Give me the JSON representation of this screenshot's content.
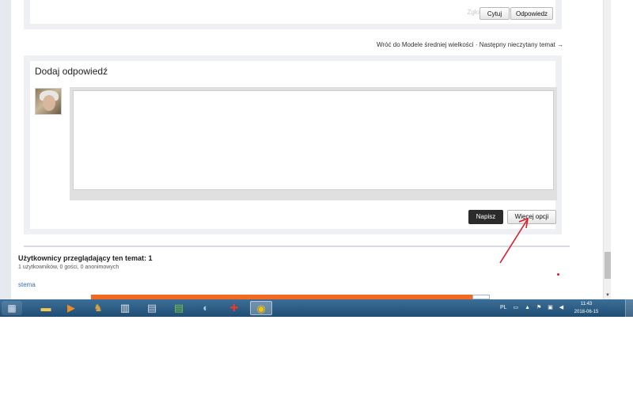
{
  "post_actions": {
    "report": "Zgłoś",
    "quote": "Cytuj",
    "reply": "Odpowiedz"
  },
  "topic_nav": {
    "back": "Wróć do Modele średniej wielkości",
    "separator": "·",
    "next": "Następny nieczytany temat →"
  },
  "reply_form": {
    "title": "Dodaj odpowiedź",
    "editor_value": "",
    "submit_label": "Napisz",
    "more_options_label": "Więcej opcji"
  },
  "viewers": {
    "title": "Użytkownicy przeglądający ten temat: 1",
    "detail": "1 użytkowników, 0 gości, 0 anonimowych"
  },
  "footer": {
    "link_fragment": "stema"
  },
  "taskbar": {
    "language": "PL",
    "time": "11:43",
    "date": "2018-06-15"
  },
  "colors": {
    "accent_orange": "#f26a21",
    "annotation_red": "#e01b2b",
    "taskbar_blue": "#2a5a83"
  }
}
